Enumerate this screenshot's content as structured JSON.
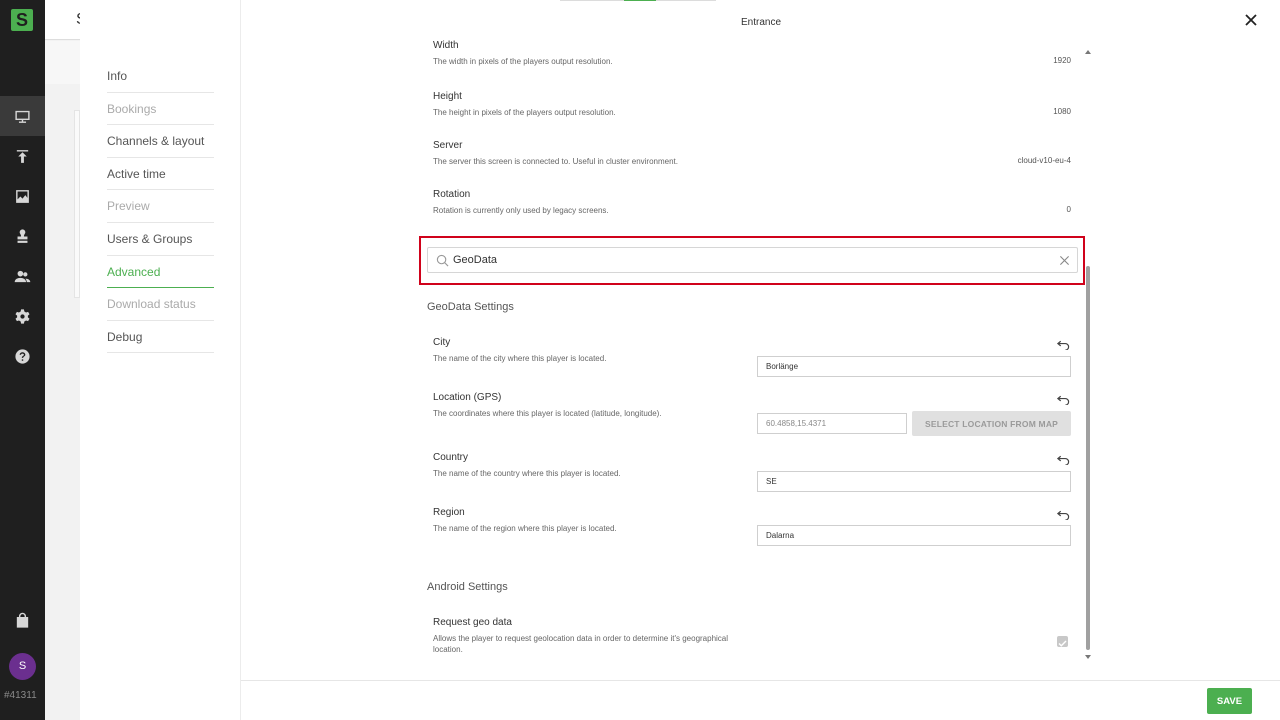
{
  "rail": {
    "logo": "S",
    "icons": [
      "monitor-icon",
      "upload-icon",
      "image-icon",
      "stamp-icon",
      "users-icon",
      "gear-icon",
      "help-icon",
      "bag-icon"
    ],
    "avatar": "S",
    "account_id": "#41311"
  },
  "background_app": {
    "title_letter": "S"
  },
  "modal": {
    "title": "Entrance",
    "nav": [
      {
        "label": "Info",
        "state": "normal"
      },
      {
        "label": "Bookings",
        "state": "disabled"
      },
      {
        "label": "Channels & layout",
        "state": "normal"
      },
      {
        "label": "Active time",
        "state": "normal"
      },
      {
        "label": "Preview",
        "state": "disabled"
      },
      {
        "label": "Users & Groups",
        "state": "normal"
      },
      {
        "label": "Advanced",
        "state": "active"
      },
      {
        "label": "Download status",
        "state": "disabled"
      },
      {
        "label": "Debug",
        "state": "normal"
      }
    ],
    "settings_top": [
      {
        "title": "Width",
        "desc": "The width in pixels of the players output resolution.",
        "value": "1920"
      },
      {
        "title": "Height",
        "desc": "The height in pixels of the players output resolution.",
        "value": "1080"
      },
      {
        "title": "Server",
        "desc": "The server this screen is connected to. Useful in cluster environment.",
        "value": "cloud-v10-eu-4"
      },
      {
        "title": "Rotation",
        "desc": "Rotation is currently only used by legacy screens.",
        "value": "0"
      }
    ],
    "search": {
      "value": "GeoData"
    },
    "geodata": {
      "heading": "GeoData Settings",
      "city": {
        "title": "City",
        "desc": "The name of the city where this player is located.",
        "value": "Borlänge"
      },
      "location": {
        "title": "Location (GPS)",
        "desc": "The coordinates where this player is located (latitude, longitude).",
        "value": "60.4858,15.4371",
        "map_button": "SELECT LOCATION FROM MAP"
      },
      "country": {
        "title": "Country",
        "desc": "The name of the country where this player is located.",
        "value": "SE"
      },
      "region": {
        "title": "Region",
        "desc": "The name of the region where this player is located.",
        "value": "Dalarna"
      }
    },
    "android": {
      "heading": "Android Settings",
      "request_geo": {
        "title": "Request geo data",
        "desc": "Allows the player to request geolocation data in order to determine it's geographical location.",
        "checked": true
      }
    },
    "save_label": "SAVE"
  },
  "colors": {
    "accent": "#4caf50",
    "highlight": "#d0021b",
    "rail_bg": "#1f1f1f",
    "avatar": "#6b2f8f"
  }
}
